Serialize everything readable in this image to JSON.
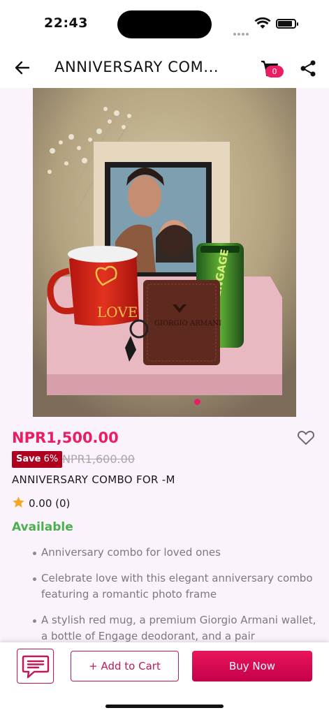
{
  "status_bar": {
    "time": "22:43",
    "icons": [
      "signal-icon",
      "wifi-icon",
      "battery-icon"
    ]
  },
  "header": {
    "title": "ANNIVERSARY COM...",
    "back_icon": "arrow-left-icon",
    "cart_icon": "cart-icon",
    "cart_count": "0",
    "share_icon": "share-icon"
  },
  "product": {
    "image_alt": "Anniversary combo: photo frame, red LOVE mug, Giorgio Armani wallet, Engage deodorant, keychain",
    "mug_text": "LOVE",
    "wallet_text": "GIORGIO ARMANI",
    "deo_text": "ENGAGE",
    "carousel_total": 1,
    "carousel_active": 1,
    "price": "NPR1,500.00",
    "save_label": "Save",
    "save_percent": "6%",
    "old_price": "NPR1,600.00",
    "name": "ANNIVERSARY COMBO FOR -M",
    "rating": "0.00 (0)",
    "availability": "Available",
    "features": [
      "Anniversary combo for loved ones",
      "Celebrate love with this elegant anniversary combo featuring a romantic photo frame",
      "A stylish red mug, a premium Giorgio Armani wallet, a bottle of Engage deodorant, and a pair"
    ]
  },
  "actions": {
    "chat_icon": "chat-icon",
    "add_to_cart": "+ Add to Cart",
    "buy_now": "Buy Now"
  },
  "colors": {
    "accent": "#e91e63",
    "save_badge": "#b00020",
    "available": "#4caf50",
    "background": "#fbf3fb"
  }
}
